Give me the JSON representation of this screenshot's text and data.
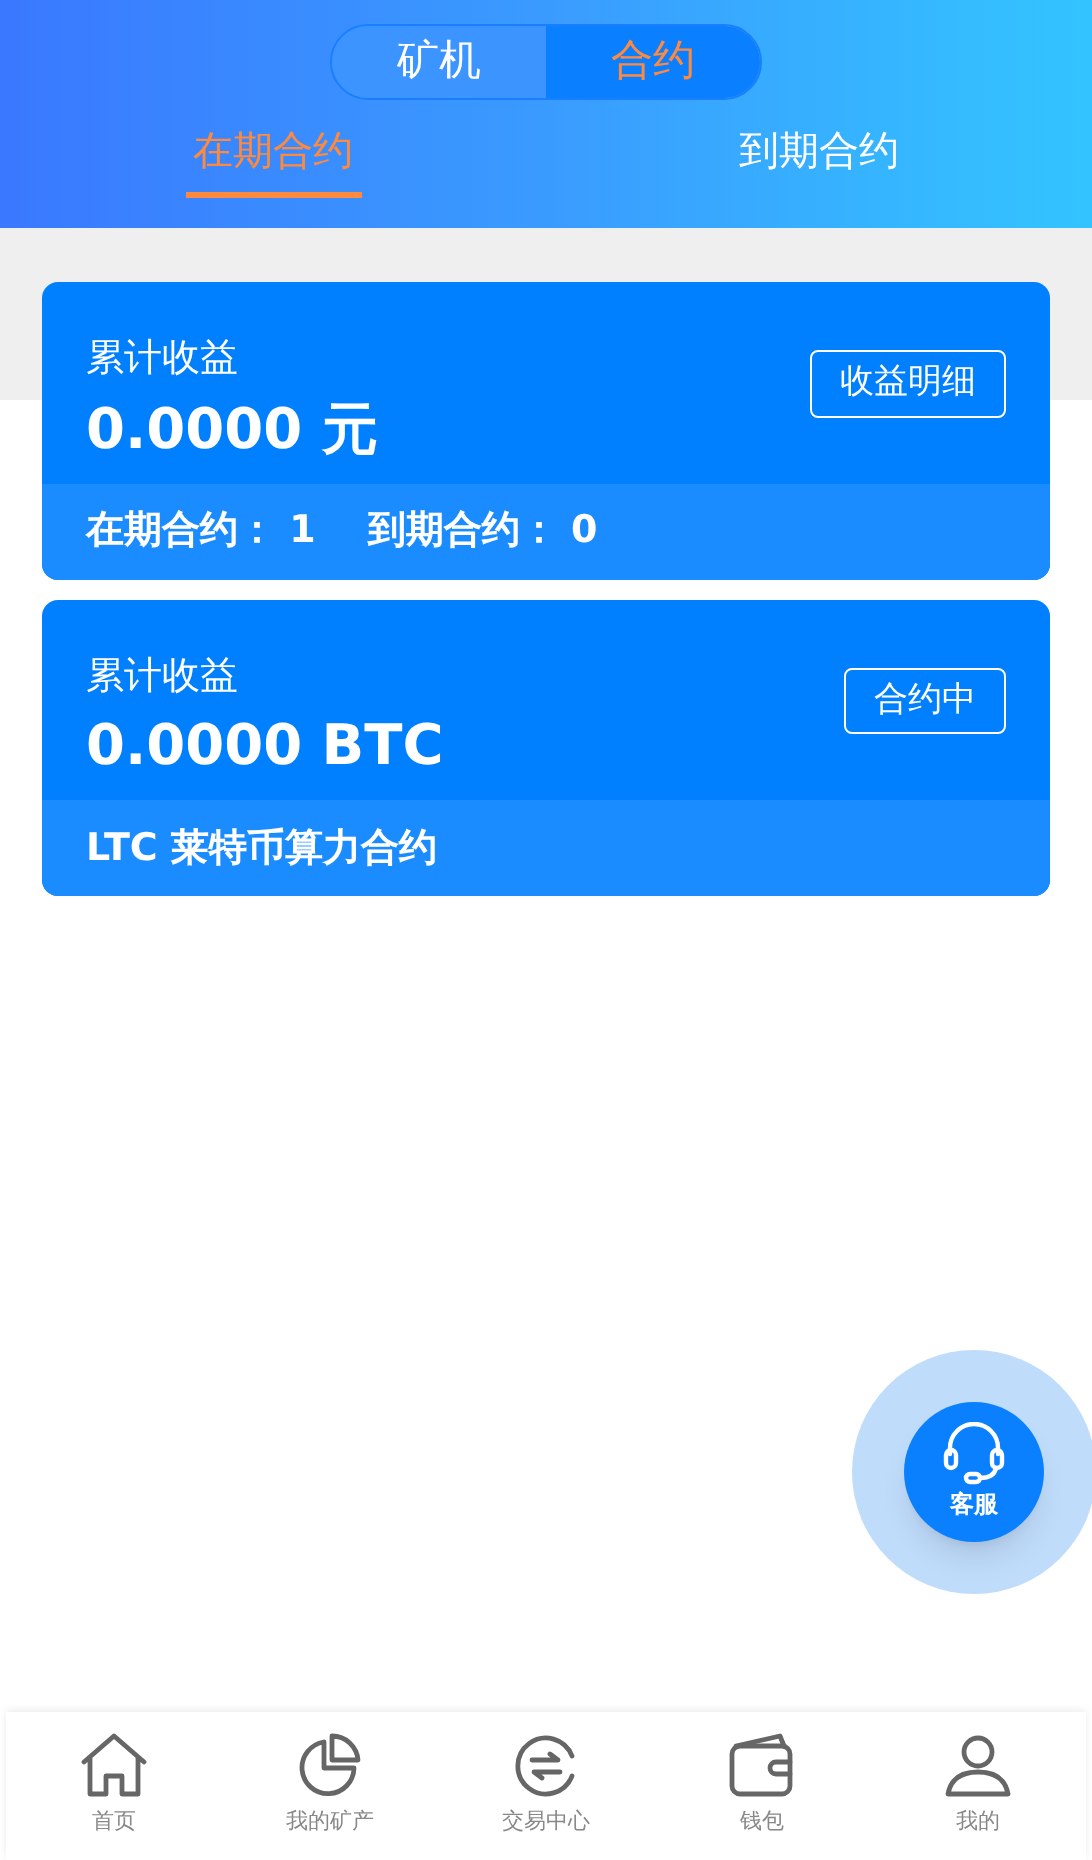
{
  "toggle": [
    {
      "label": "矿机",
      "selected": false
    },
    {
      "label": "合约",
      "selected": true
    }
  ],
  "subtabs": [
    {
      "label": "在期合约",
      "selected": true
    },
    {
      "label": "到期合约",
      "selected": false
    }
  ],
  "cards": [
    {
      "title": "累计收益",
      "amount": "0.0000 元",
      "action": "收益明细",
      "footer": [
        "在期合约： 1",
        "到期合约： 0"
      ]
    },
    {
      "title": "累计收益",
      "amount": "0.0000 BTC",
      "action": "合约中",
      "footer": [
        "LTC 莱特币算力合约"
      ]
    }
  ],
  "support": {
    "label": "客服"
  },
  "nav": [
    {
      "label": "首页",
      "kind": "home"
    },
    {
      "label": "我的矿产",
      "kind": "pie"
    },
    {
      "label": "交易中心",
      "kind": "exchange"
    },
    {
      "label": "钱包",
      "kind": "wallet"
    },
    {
      "label": "我的",
      "kind": "user"
    }
  ]
}
